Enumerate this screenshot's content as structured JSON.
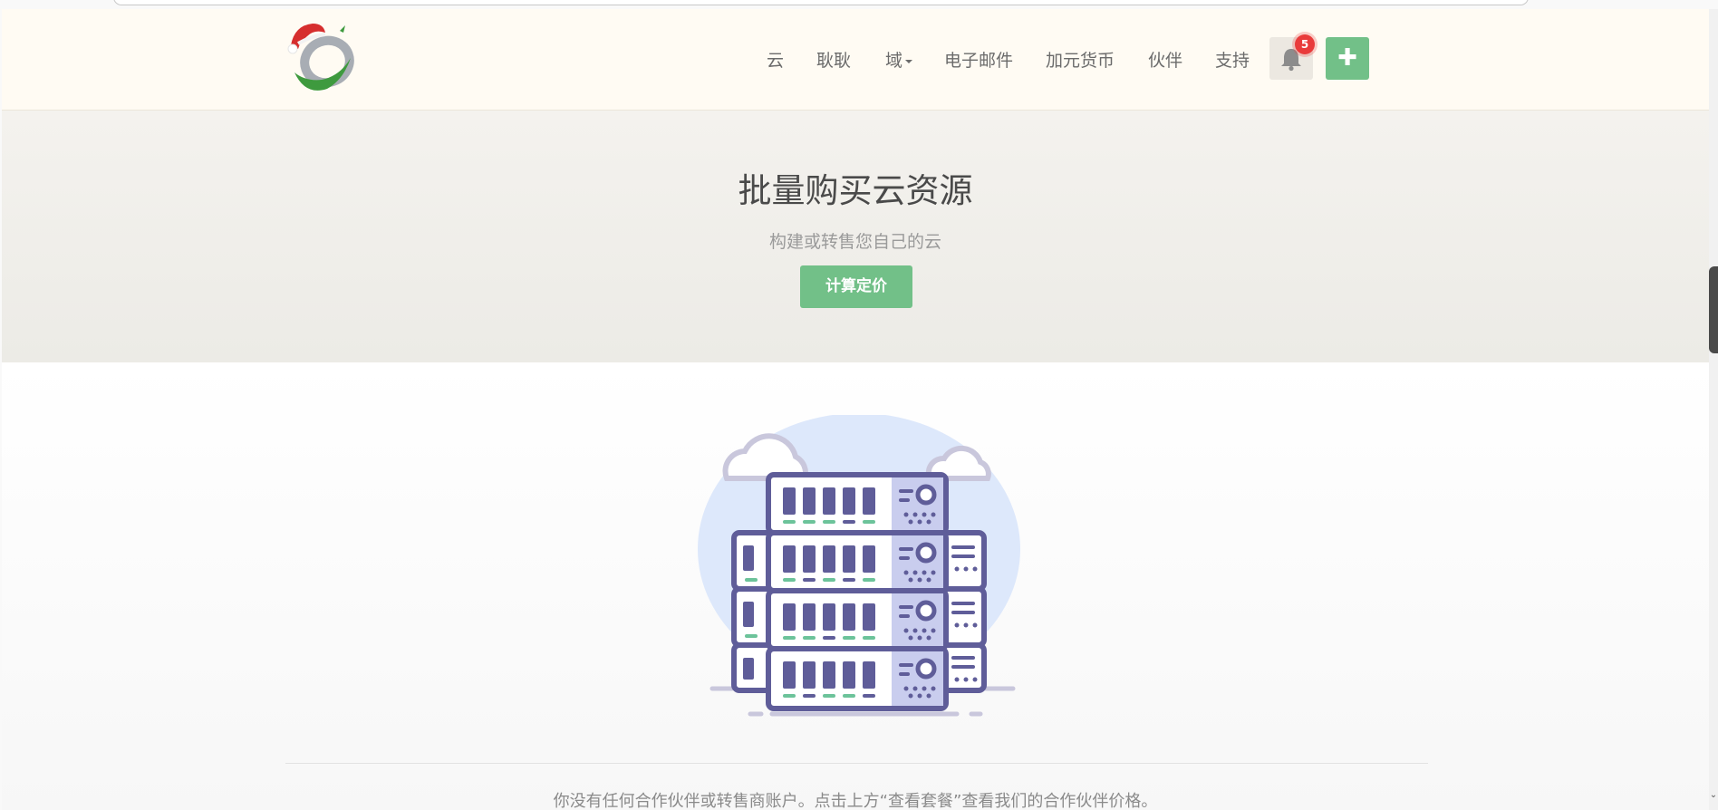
{
  "nav": {
    "items": [
      {
        "label": "云"
      },
      {
        "label": "耿耿"
      },
      {
        "label": "域"
      },
      {
        "label": "电子邮件"
      },
      {
        "label": "加元货币"
      },
      {
        "label": "伙伴"
      },
      {
        "label": "支持"
      }
    ],
    "notification_count": "5",
    "plus_label": "✚"
  },
  "hero": {
    "title": "批量购买云资源",
    "subtitle": "构建或转售您自己的云",
    "button_label": "计算定价"
  },
  "notice": "你没有任何合作伙伴或转售商账户。点击上方“查看套餐”查看我们的合作伙伴价格。",
  "colors": {
    "accent_green": "#72c088",
    "badge_red": "#e93b3b",
    "nav_bg": "#fffbf3"
  },
  "icons": [
    "santa-hat-logo",
    "bell-icon",
    "plus-icon",
    "server-rack-illustration"
  ]
}
